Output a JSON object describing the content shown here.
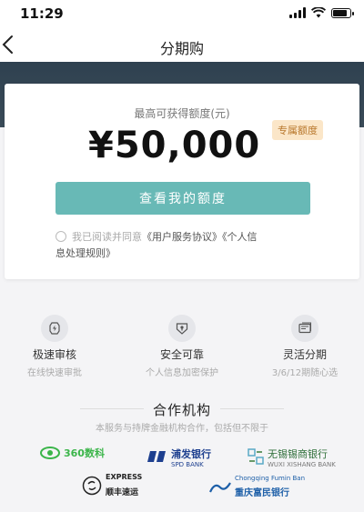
{
  "status": {
    "time": "11:29"
  },
  "nav": {
    "title": "分期购"
  },
  "card": {
    "limit_label": "最高可获得额度(元)",
    "amount": "¥50,000",
    "badge": "专属额度",
    "button_label": "查看我的额度",
    "agree_prefix": "我已阅读并同意",
    "agreement_link": "《用户服务协议》",
    "privacy_link_part1": "《个人信",
    "privacy_link_part2": "息处理规则》"
  },
  "features": [
    {
      "title": "极速审核",
      "subtitle": "在线快速审批",
      "icon": "lightning-icon"
    },
    {
      "title": "安全可靠",
      "subtitle": "个人信息加密保护",
      "icon": "shield-icon"
    },
    {
      "title": "灵活分期",
      "subtitle": "3/6/12期随心选",
      "icon": "card-icon"
    }
  ],
  "partners": {
    "title": "合作机构",
    "subtitle": "本服务与持牌金融机构合作，包括但不限于",
    "logos": [
      {
        "name": "360数科"
      },
      {
        "name": "浦发银行",
        "sub": "SPD BANK"
      },
      {
        "name": "无锡锡商银行",
        "sub": "WUXI XISHANG BANK"
      },
      {
        "name": "顺丰速运",
        "sub": "EXPRESS"
      },
      {
        "name": "重庆富民银行",
        "sub": "Chongqing Fumin Ban"
      }
    ]
  },
  "colors": {
    "primary_button": "#68b9b6",
    "badge_bg": "#fbe6c8",
    "badge_text": "#b8772c",
    "hero": "#344654"
  }
}
